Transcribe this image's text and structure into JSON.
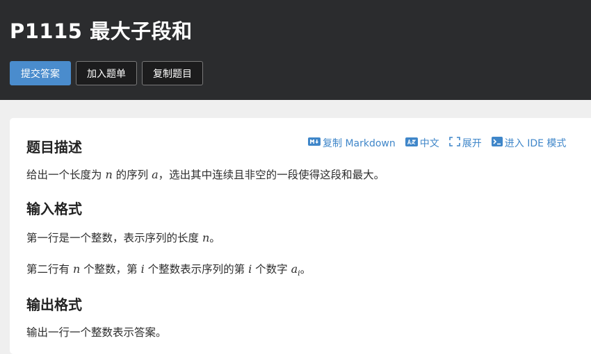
{
  "problem": {
    "title": "P1115 最大子段和"
  },
  "actions": {
    "submit": "提交答案",
    "add_to_list": "加入题单",
    "copy_problem": "复制题目"
  },
  "tools": {
    "copy_markdown": "复制 Markdown",
    "language": "中文",
    "expand": "展开",
    "ide_mode": "进入 IDE 模式"
  },
  "sections": {
    "description": {
      "title": "题目描述",
      "p1_a": "给出一个长度为 ",
      "p1_var_n": "n",
      "p1_b": " 的序列 ",
      "p1_var_a": "a",
      "p1_c": "，选出其中连续且非空的一段使得这段和最大。"
    },
    "input": {
      "title": "输入格式",
      "p1_a": "第一行是一个整数，表示序列的长度 ",
      "p1_var_n": "n",
      "p1_b": "。",
      "p2_a": "第二行有 ",
      "p2_var_n": "n",
      "p2_b": " 个整数，第 ",
      "p2_var_i": "i",
      "p2_c": " 个整数表示序列的第 ",
      "p2_var_i2": "i",
      "p2_d": " 个数字 ",
      "p2_var_a": "a",
      "p2_sub_i": "i",
      "p2_e": "。"
    },
    "output": {
      "title": "输出格式",
      "p1": "输出一行一个整数表示答案。"
    }
  },
  "colors": {
    "header_bg": "#2b2c2e",
    "primary": "#4a8ccd",
    "link": "#3f86c9"
  }
}
